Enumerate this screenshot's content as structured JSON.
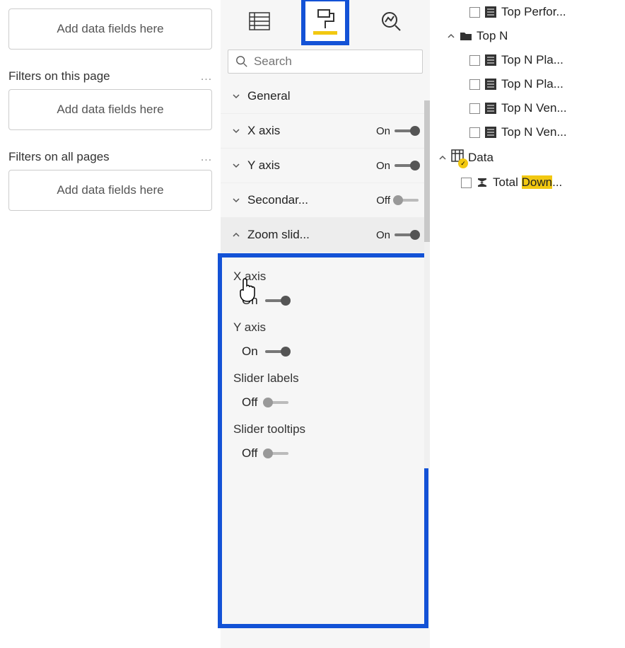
{
  "filters": {
    "visual_placeholder": "Add data fields here",
    "page_label": "Filters on this page",
    "page_placeholder": "Add data fields here",
    "all_label": "Filters on all pages",
    "all_placeholder": "Add data fields here"
  },
  "format": {
    "search_placeholder": "Search",
    "sections": {
      "general": "General",
      "xaxis": {
        "label": "X axis",
        "state": "On"
      },
      "yaxis": {
        "label": "Y axis",
        "state": "On"
      },
      "secondary": {
        "label": "Secondar...",
        "state": "Off"
      },
      "zoom": {
        "label": "Zoom slid...",
        "state": "On"
      }
    },
    "zoom_sub": {
      "xaxis_label": "X axis",
      "xaxis_state": "On",
      "yaxis_label": "Y axis",
      "yaxis_state": "On",
      "slider_labels_label": "Slider labels",
      "slider_labels_state": "Off",
      "slider_tooltips_label": "Slider tooltips",
      "slider_tooltips_state": "Off"
    }
  },
  "fields": {
    "top_perfor": "Top Perfor...",
    "topn_group": "Top N",
    "topn_pla1": "Top N Pla...",
    "topn_pla2": "Top N Pla...",
    "topn_ven1": "Top N Ven...",
    "topn_ven2": "Top N Ven...",
    "data_group": "Data",
    "total_down_pre": "Total ",
    "total_down_hl": "Down"
  }
}
